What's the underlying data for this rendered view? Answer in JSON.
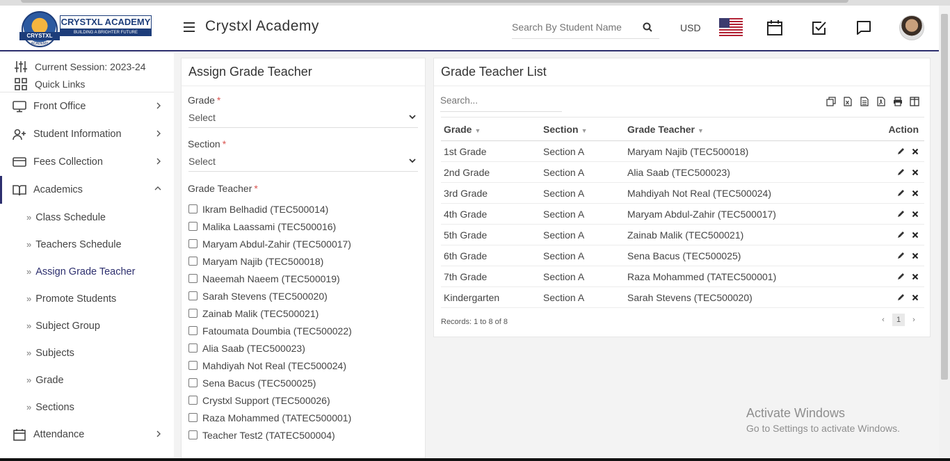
{
  "app": {
    "logo_name": "CRYSTXL ACADEMY",
    "logo_tagline": "BUILDING A BRIGHTER FUTURE",
    "logo_seal_text": "CRYSTXL",
    "logo_seal_sub": "ACADEMY",
    "brand": "Crystxl Academy"
  },
  "header": {
    "search_placeholder": "Search By Student Name",
    "currency": "USD",
    "icons": [
      "search-icon",
      "us-flag-icon",
      "calendar-icon",
      "task-check-icon",
      "chat-icon",
      "user-avatar"
    ]
  },
  "sidebar": {
    "session": "Current Session: 2023-24",
    "quick_links": "Quick Links",
    "menu": [
      {
        "label": "Front Office",
        "icon": "monitor-icon"
      },
      {
        "label": "Student Information",
        "icon": "user-plus-icon"
      },
      {
        "label": "Fees Collection",
        "icon": "credit-card-icon"
      },
      {
        "label": "Academics",
        "icon": "book-icon"
      }
    ],
    "submenu": [
      {
        "label": "Class Schedule"
      },
      {
        "label": "Teachers Schedule"
      },
      {
        "label": "Assign Grade Teacher"
      },
      {
        "label": "Promote Students"
      },
      {
        "label": "Subject Group"
      },
      {
        "label": "Subjects"
      },
      {
        "label": "Grade"
      },
      {
        "label": "Sections"
      }
    ],
    "attendance": "Attendance"
  },
  "assign_form": {
    "title": "Assign Grade Teacher",
    "grade_label": "Grade",
    "grade_value": "Select",
    "section_label": "Section",
    "section_value": "Select",
    "teacher_label": "Grade Teacher",
    "required_mark": "*",
    "teachers": [
      "Ikram Belhadid (TEC500014)",
      "Malika Laassami (TEC500016)",
      "Maryam Abdul-Zahir (TEC500017)",
      "Maryam Najib (TEC500018)",
      "Naeemah Naeem (TEC500019)",
      "Sarah Stevens (TEC500020)",
      "Zainab Malik (TEC500021)",
      "Fatoumata Doumbia (TEC500022)",
      "Alia Saab (TEC500023)",
      "Mahdiyah Not Real (TEC500024)",
      "Sena Bacus (TEC500025)",
      "Crystxl Support (TEC500026)",
      "Raza Mohammed (TATEC500001)",
      "Teacher Test2 (TATEC500004)"
    ]
  },
  "list": {
    "title": "Grade Teacher List",
    "search_placeholder": "Search...",
    "columns": [
      "Grade",
      "Section",
      "Grade Teacher",
      "Action"
    ],
    "rows": [
      {
        "grade": "1st Grade",
        "section": "Section A",
        "teacher": "Maryam Najib (TEC500018)"
      },
      {
        "grade": "2nd Grade",
        "section": "Section A",
        "teacher": "Alia Saab (TEC500023)"
      },
      {
        "grade": "3rd Grade",
        "section": "Section A",
        "teacher": "Mahdiyah Not Real (TEC500024)"
      },
      {
        "grade": "4th Grade",
        "section": "Section A",
        "teacher": "Maryam Abdul-Zahir (TEC500017)"
      },
      {
        "grade": "5th Grade",
        "section": "Section A",
        "teacher": "Zainab Malik (TEC500021)"
      },
      {
        "grade": "6th Grade",
        "section": "Section A",
        "teacher": "Sena Bacus (TEC500025)"
      },
      {
        "grade": "7th Grade",
        "section": "Section A",
        "teacher": "Raza Mohammed (TATEC500001)"
      },
      {
        "grade": "Kindergarten",
        "section": "Section A",
        "teacher": "Sarah Stevens (TEC500020)"
      }
    ],
    "records": "Records: 1 to 8 of 8",
    "page": "1",
    "prev": "‹",
    "next": "›"
  },
  "watermark": {
    "line1": "Activate Windows",
    "line2": "Go to Settings to activate Windows."
  },
  "colors": {
    "accent": "#2d2f6e",
    "required": "#d9534f"
  }
}
